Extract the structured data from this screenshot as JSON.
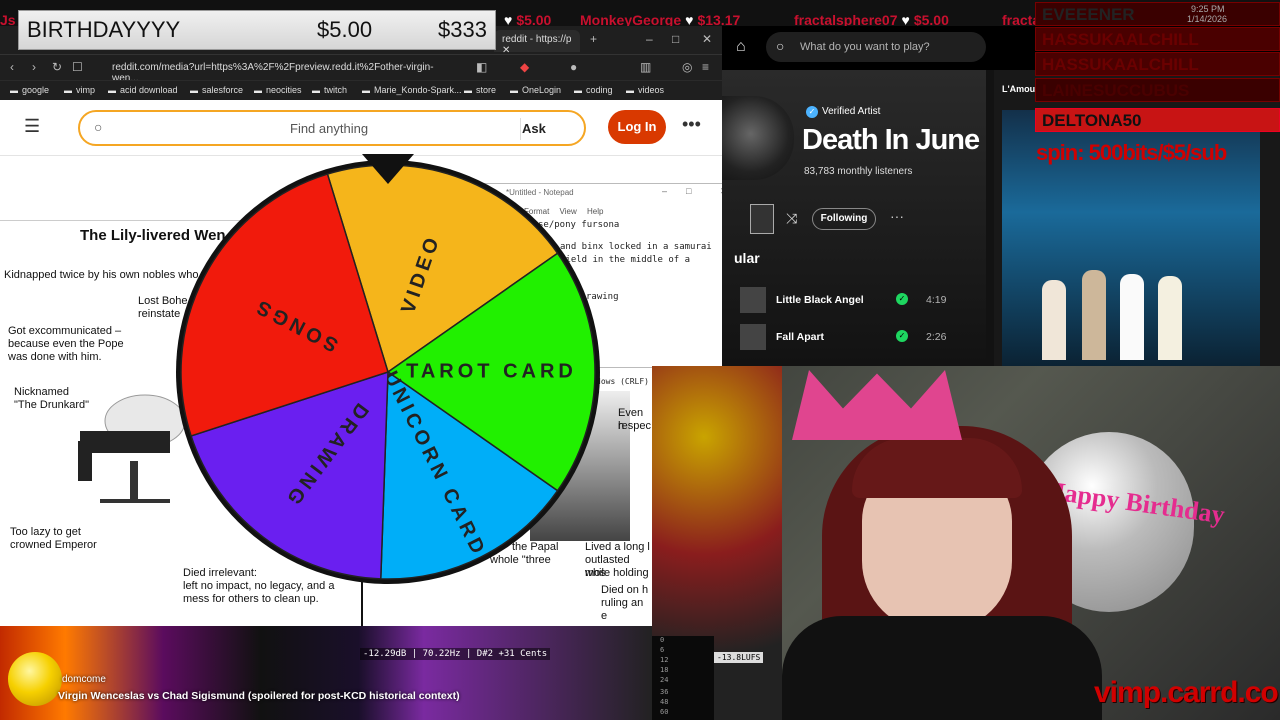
{
  "ticker": [
    {
      "name": "",
      "amount": "$5.00"
    },
    {
      "name": "MonkeyGeorge",
      "amount": "$13.17"
    },
    {
      "name": "fractalsphere07",
      "amount": "$5.00"
    },
    {
      "name": "fractal",
      "amount": ""
    }
  ],
  "banner": {
    "name": "BIRTHDAYYYY",
    "amount": "$5.00",
    "total": "$333"
  },
  "browser": {
    "tab_title": "reddit - https://p",
    "url": "reddit.com/media?url=https%3A%2F%2Fpreview.redd.it%2Fother-virgin-wen...",
    "bookmarks": [
      "google",
      "vimp",
      "acid download",
      "salesforce",
      "neocities",
      "twitch",
      "Marie_Kondo-Spark...",
      "store",
      "OneLogin",
      "coding",
      "videos"
    ],
    "search_placeholder": "Find anything",
    "ask_label": "Ask",
    "login_label": "Log In"
  },
  "comic": {
    "title": "The Lily-livered Wen",
    "texts": [
      "Kidnapped twice by his own nobles who",
      "Lost Bohe",
      "reinstate",
      "Got excommunicated –",
      "because even the Pope",
      "was done with him.",
      "Nicknamed",
      "\"The Drunkard\"",
      "Too lazy to get",
      "crowned Emperor",
      "Died irrelevant:",
      "left no impact, no legacy, and a",
      "mess for others to clean up.",
      "Even h",
      "respec",
      "the Papal",
      "whole \"three",
      "Lived a long l",
      "outlasted mos",
      "while holding",
      "Died on h",
      "ruling an e"
    ]
  },
  "notepad": {
    "title": "*Untitled - Notepad",
    "menu": "Format View Help",
    "lines": [
      "se/pony fursona",
      "and binx locked in a samurai",
      "field in the middle of a",
      "rawing"
    ],
    "status": "dows (CRLF)"
  },
  "wheel": {
    "pointer_color": "#111111",
    "segments": [
      {
        "label": "VIDEO",
        "color": "#f5b51b",
        "start": -17,
        "end": 55
      },
      {
        "label": "TAROT CARD",
        "color": "#21f000",
        "start": 55,
        "end": 125
      },
      {
        "label": "UNICORN CARD",
        "color": "#00aef8",
        "start": 125,
        "end": 182
      },
      {
        "label": "DRAWING",
        "color": "#6a1ff0",
        "start": 182,
        "end": 252
      },
      {
        "label": "SONGS",
        "color": "#f11a0c",
        "start": 252,
        "end": 343
      }
    ]
  },
  "spotify": {
    "search_placeholder": "What do you want to play?",
    "verified": "Verified Artist",
    "artist": "Death In June",
    "listeners": "83,783 monthly listeners",
    "following": "Following",
    "popular": "ular",
    "tracks": [
      {
        "title": "Little Black Angel",
        "duration": "4:19"
      },
      {
        "title": "Fall Apart",
        "duration": "2:26"
      }
    ],
    "radio": "L'Amour Toujours Radio",
    "time": "9:25 PM",
    "date": "1/14/2026"
  },
  "chat": {
    "rows": [
      "EVEEENER",
      "HASSUKAALCHILL",
      "HASSUKAALCHILL",
      "LAINESUCCUBUS",
      "DELTONA50"
    ],
    "spin": "spin: 500bits/$5/sub"
  },
  "cam": {
    "birthday_text": "Happy Birthday",
    "logo": "vimp.carrd.co"
  },
  "bottom": {
    "domcome": "domcome",
    "now_playing": "Virgin Wenceslas vs Chad Sigismund (spoilered for post-KCD historical context)",
    "tuner": "-12.29dB | 70.22Hz | D#2 +31 Cents",
    "lufs": "-13.8LUFS",
    "meter_ticks": [
      "0",
      "6",
      "12",
      "18",
      "24",
      "36",
      "48",
      "60"
    ]
  }
}
